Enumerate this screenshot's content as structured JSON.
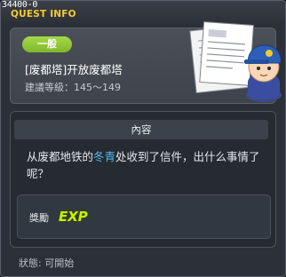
{
  "window": {
    "quest_id": "34400-0",
    "title": "QUEST INFO"
  },
  "header": {
    "category": "一般",
    "quest_name": "[废都塔]开放废都塔",
    "level_label": "建議等級",
    "level_range": "145～149"
  },
  "content": {
    "section_title": "內容",
    "text_before": "从废都地铁的",
    "text_highlight": "冬青",
    "text_after": "处收到了信件，出什么事情了呢？"
  },
  "reward": {
    "label": "獎勵",
    "exp_text": "EXP"
  },
  "status": {
    "text": "狀態: 可開始"
  },
  "icons": {
    "exp": "exp-icon",
    "illustration": "quest-letter-illustration"
  },
  "colors": {
    "window_bg": "#2c3038",
    "title": "#f4ca2f",
    "category_pill": "#8cc73f",
    "highlight": "#4fb8ef",
    "exp": "#c6f000"
  }
}
